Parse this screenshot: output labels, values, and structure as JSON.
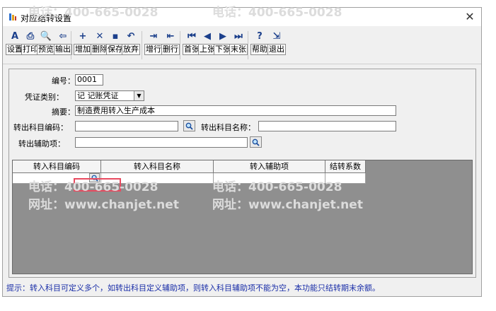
{
  "window": {
    "title": "对应结转设置",
    "close_label": "✕"
  },
  "toolbar": [
    {
      "label": "设置",
      "icon": "A"
    },
    {
      "label": "打印",
      "icon": "⎙"
    },
    {
      "label": "预览",
      "icon": "🔍"
    },
    {
      "label": "输出",
      "icon": "⇦"
    },
    {
      "label": "增加",
      "icon": "+"
    },
    {
      "label": "删除",
      "icon": "✕"
    },
    {
      "label": "保存",
      "icon": "▪"
    },
    {
      "label": "放弃",
      "icon": "↶"
    },
    {
      "label": "增行",
      "icon": "⇥"
    },
    {
      "label": "删行",
      "icon": "⇤"
    },
    {
      "label": "首张",
      "icon": "⏮"
    },
    {
      "label": "上张",
      "icon": "◀"
    },
    {
      "label": "下张",
      "icon": "▶"
    },
    {
      "label": "末张",
      "icon": "⏭"
    },
    {
      "label": "帮助",
      "icon": "?"
    },
    {
      "label": "退出",
      "icon": "⇲"
    }
  ],
  "form": {
    "code_label": "编号：",
    "code_value": "0001",
    "voucher_type_label": "凭证类别：",
    "voucher_type_value": "记  记账凭证",
    "summary_label": "摘要：",
    "summary_value": "制造费用转入生产成本",
    "out_account_code_label": "转出科目编码：",
    "out_account_code_value": "",
    "out_account_name_label": "转出科目名称：",
    "out_account_name_value": "",
    "out_aux_label": "转出辅助项：",
    "out_aux_value": ""
  },
  "grid": {
    "columns": [
      "转入科目编码",
      "转入科目名称",
      "转入辅助项",
      "结转系数"
    ]
  },
  "status": {
    "hint": "提示：转入科目可定义多个，如转出科目定义辅助项，则转入科目辅助项不能为空，本功能只结转期末余额。"
  },
  "watermark": {
    "phone": "电话：400-665-0028",
    "site": "网址：www.chanjet.net"
  }
}
